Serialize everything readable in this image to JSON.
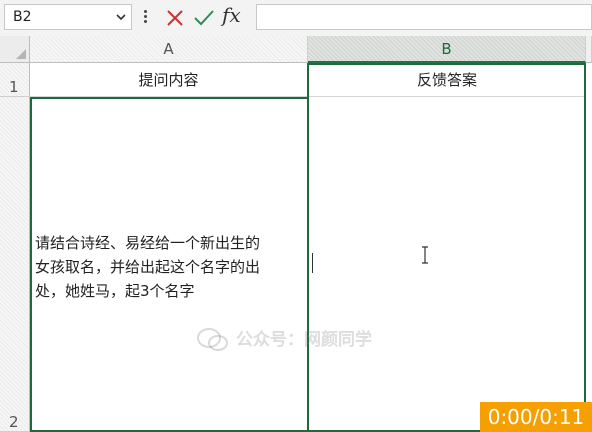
{
  "formula_bar": {
    "name_box_value": "B2",
    "fx_label": "fx",
    "formula_value": ""
  },
  "columns": [
    "A",
    "B"
  ],
  "rows": [
    "1",
    "2"
  ],
  "cells": {
    "A1": "提问内容",
    "B1": "反馈答案",
    "A2": "请结合诗经、易经给一个新出生的\n女孩取名，并给出起这个名字的出\n处，她姓马，起3个名字",
    "B2": ""
  },
  "watermark": {
    "text": "公众号：网颜同学"
  },
  "video_timer": "0:00/0:11",
  "colors": {
    "accent": "#217346",
    "timer_bg": "#f5a000",
    "cancel_red": "#d03030",
    "enter_green": "#2e8b57"
  }
}
